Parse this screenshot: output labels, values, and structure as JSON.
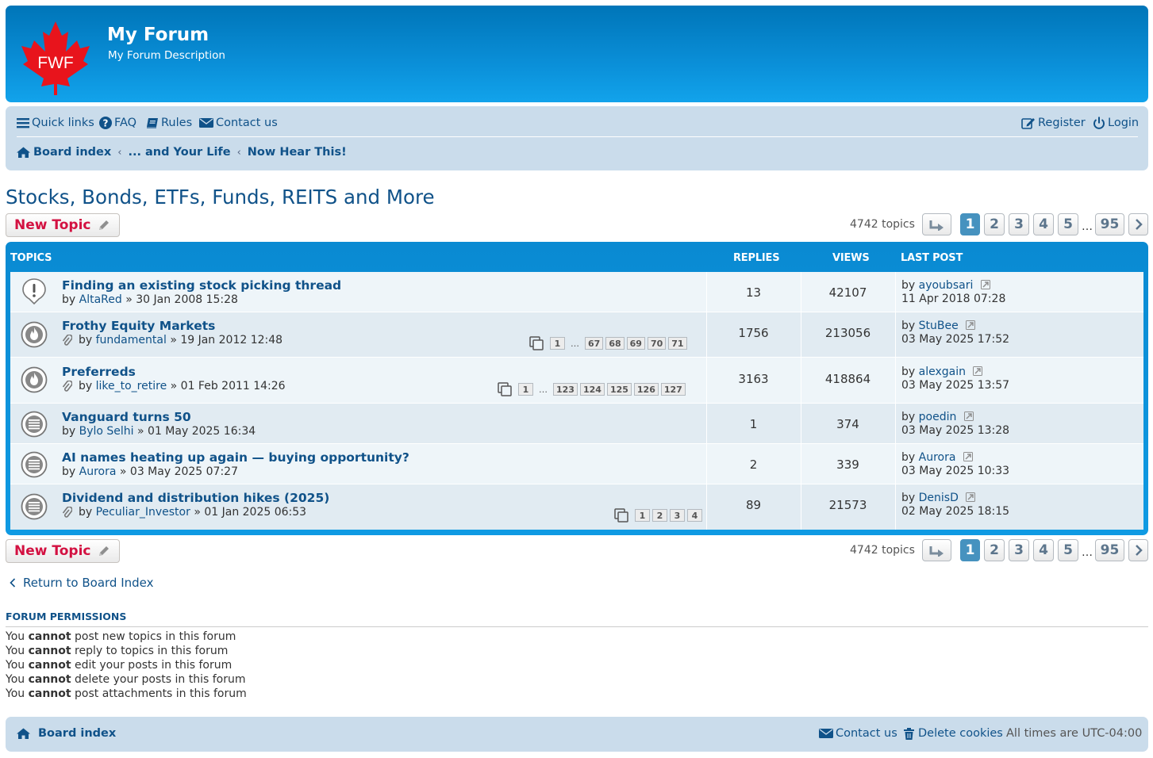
{
  "header": {
    "logo_text": "FWF",
    "site_title": "My Forum",
    "site_description": "My Forum Description"
  },
  "nav": {
    "quick_links": "Quick links",
    "faq": "FAQ",
    "rules": "Rules",
    "contact": "Contact us",
    "register": "Register",
    "login": "Login"
  },
  "breadcrumbs": [
    "Board index",
    "... and Your Life",
    "Now Hear This!"
  ],
  "forum_title": "Stocks, Bonds, ETFs, Funds, REITS and More",
  "toolbar": {
    "new_topic": "New Topic",
    "topic_count": "4742 topics",
    "pages": [
      "1",
      "2",
      "3",
      "4",
      "5"
    ],
    "ellipsis": "…",
    "last_page": "95"
  },
  "table": {
    "headers": {
      "topics": "TOPICS",
      "replies": "REPLIES",
      "views": "VIEWS",
      "last_post": "LAST POST"
    },
    "rows": [
      {
        "title": "Finding an existing stock picking thread",
        "by": "by",
        "author": "AltaRed",
        "date": "» 30 Jan 2008 15:28",
        "replies": "13",
        "views": "42107",
        "lp_by": "by",
        "lp_user": "ayoubsari",
        "lp_date": "11 Apr 2018 07:28",
        "icon": "announcement-icon"
      },
      {
        "title": "Frothy Equity Markets",
        "by": "by",
        "author": "fundamental",
        "date": "» 19 Jan 2012 12:48",
        "replies": "1756",
        "views": "213056",
        "lp_by": "by",
        "lp_user": "StuBee",
        "lp_date": "03 May 2025 17:52",
        "icon": "hot-topic-icon",
        "pages": [
          "1",
          "…",
          "67",
          "68",
          "69",
          "70",
          "71"
        ]
      },
      {
        "title": "Preferreds",
        "by": "by",
        "author": "like_to_retire",
        "date": "» 01 Feb 2011 14:26",
        "replies": "3163",
        "views": "418864",
        "lp_by": "by",
        "lp_user": "alexgain",
        "lp_date": "03 May 2025 13:57",
        "icon": "hot-topic-icon",
        "pages": [
          "1",
          "…",
          "123",
          "124",
          "125",
          "126",
          "127"
        ]
      },
      {
        "title": "Vanguard turns 50",
        "by": "by",
        "author": "Bylo Selhi",
        "date": "» 01 May 2025 16:34",
        "replies": "1",
        "views": "374",
        "lp_by": "by",
        "lp_user": "poedin",
        "lp_date": "03 May 2025 13:28",
        "icon": "topic-icon"
      },
      {
        "title": "AI names heating up again — buying opportunity?",
        "by": "by",
        "author": "Aurora",
        "date": "» 03 May 2025 07:27",
        "replies": "2",
        "views": "339",
        "lp_by": "by",
        "lp_user": "Aurora",
        "lp_date": "03 May 2025 10:33",
        "icon": "topic-icon"
      },
      {
        "title": "Dividend and distribution hikes (2025)",
        "by": "by",
        "author": "Peculiar_Investor",
        "date": "» 01 Jan 2025 06:53",
        "replies": "89",
        "views": "21573",
        "lp_by": "by",
        "lp_user": "DenisD",
        "lp_date": "02 May 2025 18:15",
        "icon": "topic-icon",
        "pages": [
          "1",
          "2",
          "3",
          "4"
        ]
      }
    ]
  },
  "return_link": "Return to Board Index",
  "permissions": {
    "heading": "FORUM PERMISSIONS",
    "you": "You",
    "cannot": "cannot",
    "lines": [
      "post new topics in this forum",
      "reply to topics in this forum",
      "edit your posts in this forum",
      "delete your posts in this forum",
      "post attachments in this forum"
    ]
  },
  "footer": {
    "board_index": "Board index",
    "contact": "Contact us",
    "delete_cookies": "Delete cookies",
    "timezone": "All times are UTC-04:00"
  },
  "colors": {
    "header_blue": "#0a8fd8",
    "nav_bg": "#cadceb",
    "link": "#105289",
    "new_topic_red": "#d31141",
    "active_page": "#4692bf"
  }
}
